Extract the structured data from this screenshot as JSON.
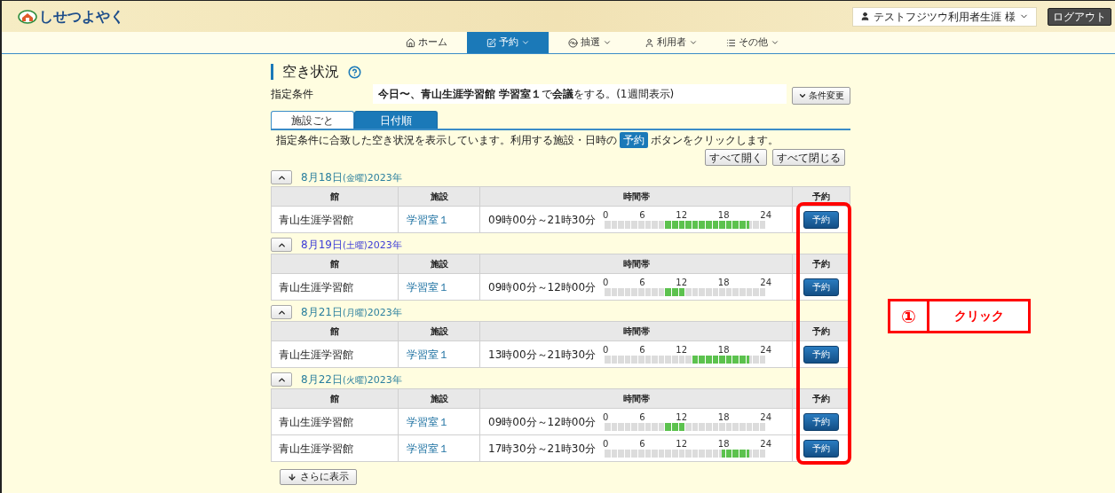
{
  "header": {
    "logo_text": "しせつよやく",
    "user_name": "テストフジツウ利用者生涯 様",
    "logout": "ログアウト"
  },
  "nav": [
    {
      "label": "ホーム",
      "dropdown": false,
      "selected": false
    },
    {
      "label": "予約",
      "dropdown": true,
      "selected": true
    },
    {
      "label": "抽選",
      "dropdown": true,
      "selected": false
    },
    {
      "label": "利用者",
      "dropdown": true,
      "selected": false
    },
    {
      "label": "その他",
      "dropdown": true,
      "selected": false
    }
  ],
  "page_title": "空き状況",
  "condition": {
    "label": "指定条件",
    "value": "**今日〜、青山生涯学習館 学習室１**で**会議**をする。(1週間表示)",
    "change_button": "条件変更"
  },
  "tabs": [
    {
      "label": "施設ごと",
      "selected": false
    },
    {
      "label": "日付順",
      "selected": true
    }
  ],
  "description": {
    "before": "指定条件に合致した空き状況を表示しています。利用する施設・日時の",
    "badge": "予約",
    "after": "ボタンをクリックします。"
  },
  "expand_all": "すべて開く",
  "collapse_all": "すべて閉じる",
  "groups": [
    {
      "date": "8月18日",
      "weekday": "(金曜)",
      "year": "2023年",
      "color": "#2a7f9e",
      "expanded": true,
      "columns": [
        "館",
        "施設",
        "時間帯",
        "予約"
      ],
      "rows": [
        {
          "hall": "青山生涯学習館",
          "facility": "学習室１",
          "time": "09時00分～21時30分",
          "ticks": [
            "0",
            "6",
            "12",
            "18",
            "24"
          ],
          "button": "予約",
          "free": [
            false,
            false,
            false,
            false,
            false,
            false,
            false,
            false,
            false,
            false,
            false,
            false,
            false,
            false,
            false,
            false,
            false,
            false,
            true,
            true,
            true,
            true,
            true,
            true,
            true,
            true,
            true,
            true,
            true,
            true,
            true,
            true,
            true,
            true,
            true,
            true,
            true,
            true,
            true,
            true,
            true,
            true,
            true,
            false,
            false,
            false,
            false,
            false
          ]
        }
      ]
    },
    {
      "date": "8月19日",
      "weekday": "(土曜)",
      "year": "2023年",
      "color": "#3b3bd6",
      "expanded": true,
      "columns": [
        "館",
        "施設",
        "時間帯",
        "予約"
      ],
      "rows": [
        {
          "hall": "青山生涯学習館",
          "facility": "学習室１",
          "time": "09時00分～12時00分",
          "ticks": [
            "0",
            "6",
            "12",
            "18",
            "24"
          ],
          "button": "予約",
          "free": [
            false,
            false,
            false,
            false,
            false,
            false,
            false,
            false,
            false,
            false,
            false,
            false,
            false,
            false,
            false,
            false,
            false,
            false,
            true,
            true,
            true,
            true,
            true,
            true,
            false,
            false,
            false,
            false,
            false,
            false,
            false,
            false,
            false,
            false,
            false,
            false,
            false,
            false,
            false,
            false,
            false,
            false,
            false,
            false,
            false,
            false,
            false,
            false
          ]
        }
      ]
    },
    {
      "date": "8月21日",
      "weekday": "(月曜)",
      "year": "2023年",
      "color": "#2a7f9e",
      "expanded": true,
      "columns": [
        "館",
        "施設",
        "時間帯",
        "予約"
      ],
      "rows": [
        {
          "hall": "青山生涯学習館",
          "facility": "学習室１",
          "time": "13時00分～21時30分",
          "ticks": [
            "0",
            "6",
            "12",
            "18",
            "24"
          ],
          "button": "予約",
          "free": [
            false,
            false,
            false,
            false,
            false,
            false,
            false,
            false,
            false,
            false,
            false,
            false,
            false,
            false,
            false,
            false,
            false,
            false,
            false,
            false,
            false,
            false,
            false,
            false,
            false,
            false,
            true,
            true,
            true,
            true,
            true,
            true,
            true,
            true,
            true,
            true,
            true,
            true,
            true,
            true,
            true,
            true,
            true,
            false,
            false,
            false,
            false,
            false
          ]
        }
      ]
    },
    {
      "date": "8月22日",
      "weekday": "(火曜)",
      "year": "2023年",
      "color": "#2a7f9e",
      "expanded": true,
      "columns": [
        "館",
        "施設",
        "時間帯",
        "予約"
      ],
      "rows": [
        {
          "hall": "青山生涯学習館",
          "facility": "学習室１",
          "time": "09時00分～12時00分",
          "ticks": [
            "0",
            "6",
            "12",
            "18",
            "24"
          ],
          "button": "予約",
          "free": [
            false,
            false,
            false,
            false,
            false,
            false,
            false,
            false,
            false,
            false,
            false,
            false,
            false,
            false,
            false,
            false,
            false,
            false,
            true,
            true,
            true,
            true,
            true,
            true,
            false,
            false,
            false,
            false,
            false,
            false,
            false,
            false,
            false,
            false,
            false,
            false,
            false,
            false,
            false,
            false,
            false,
            false,
            false,
            false,
            false,
            false,
            false,
            false
          ]
        },
        {
          "hall": "青山生涯学習館",
          "facility": "学習室１",
          "time": "17時30分～21時30分",
          "ticks": [
            "0",
            "6",
            "12",
            "18",
            "24"
          ],
          "button": "予約",
          "free": [
            false,
            false,
            false,
            false,
            false,
            false,
            false,
            false,
            false,
            false,
            false,
            false,
            false,
            false,
            false,
            false,
            false,
            false,
            false,
            false,
            false,
            false,
            false,
            false,
            false,
            false,
            false,
            false,
            false,
            false,
            false,
            false,
            false,
            false,
            false,
            true,
            true,
            true,
            true,
            true,
            true,
            true,
            true,
            false,
            false,
            false,
            false,
            false
          ]
        }
      ]
    }
  ],
  "more_button": "さらに表示",
  "annotation": {
    "number": "①",
    "label": "クリック"
  }
}
